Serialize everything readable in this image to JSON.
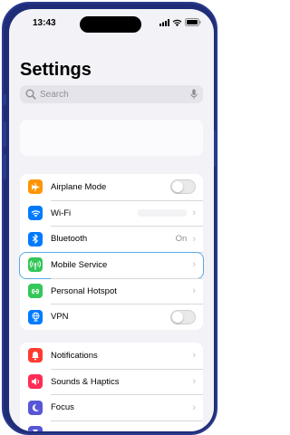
{
  "status_bar": {
    "time": "13:43"
  },
  "page_title": "Settings",
  "search": {
    "placeholder": "Search"
  },
  "groups": [
    {
      "rows": [
        {
          "label": "Airplane Mode",
          "icon": "airplane-icon",
          "icon_color": "#ff9500",
          "accessory": "toggle",
          "toggle_on": false
        },
        {
          "label": "Wi-Fi",
          "icon": "wifi-icon",
          "icon_color": "#007aff",
          "accessory": "chevron"
        },
        {
          "label": "Bluetooth",
          "icon": "bluetooth-icon",
          "icon_color": "#007aff",
          "value": "On",
          "accessory": "chevron"
        },
        {
          "label": "Mobile Service",
          "icon": "antenna-icon",
          "icon_color": "#34c759",
          "accessory": "chevron",
          "highlighted": true
        },
        {
          "label": "Personal Hotspot",
          "icon": "hotspot-icon",
          "icon_color": "#34c759",
          "accessory": "chevron"
        },
        {
          "label": "VPN",
          "icon": "vpn-globe-icon",
          "icon_color": "#007aff",
          "accessory": "toggle",
          "toggle_on": false
        }
      ]
    },
    {
      "rows": [
        {
          "label": "Notifications",
          "icon": "bell-icon",
          "icon_color": "#ff3b30",
          "accessory": "chevron"
        },
        {
          "label": "Sounds & Haptics",
          "icon": "speaker-icon",
          "icon_color": "#ff2d55",
          "accessory": "chevron"
        },
        {
          "label": "Focus",
          "icon": "moon-icon",
          "icon_color": "#5856d6",
          "accessory": "chevron"
        },
        {
          "label": "",
          "icon": "hourglass-icon",
          "icon_color": "#5856d6",
          "accessory": "chevron"
        }
      ]
    }
  ],
  "colors": {
    "highlight_outline": "#5aa9e6",
    "device_frame": "#2a3a8c"
  }
}
